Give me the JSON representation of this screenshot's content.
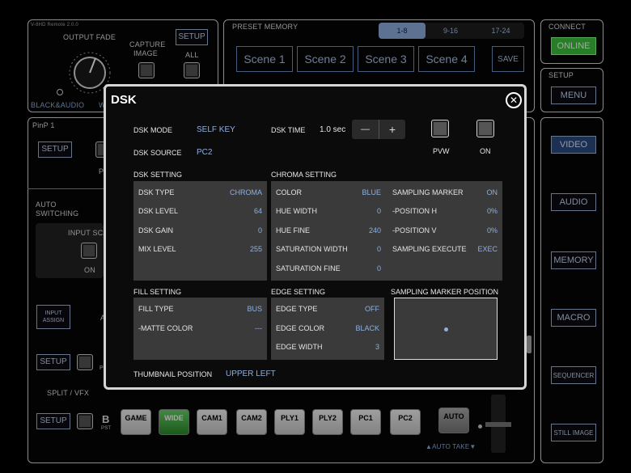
{
  "header": {
    "model": "V-8HD Remote 2.0.0"
  },
  "output_fade": {
    "title": "OUTPUT FADE",
    "capture_image": "CAPTURE IMAGE",
    "setup": "SETUP",
    "all": "ALL",
    "black_audio": "BLACK&AUDIO",
    "w_cut": "W"
  },
  "preset": {
    "title": "PRESET MEMORY",
    "tabs": [
      "1-8",
      "9-16",
      "17-24"
    ],
    "scenes": [
      "Scene 1",
      "Scene 2",
      "Scene 3",
      "Scene 4"
    ],
    "save": "SAVE"
  },
  "connect": {
    "title": "CONNECT",
    "status": "ONLINE"
  },
  "setup_side": {
    "title": "SETUP",
    "menu": "MENU"
  },
  "side_nav": [
    "VIDEO",
    "AUDIO",
    "MEMORY",
    "MACRO",
    "SEQUENCER",
    "STILL IMAGE"
  ],
  "left": {
    "pinp": "PinP 1",
    "pinp_setup": "SETUP",
    "pinp_p": "P",
    "auto_switching": "AUTO SWITCHING",
    "input_scan": "INPUT SCA",
    "on": "ON",
    "input_assign": "INPUT ASSIGN",
    "a_cut": "A",
    "setup2": "SETUP",
    "p2": "P",
    "split_vfx": "SPLIT / VFX",
    "setup3": "SETUP",
    "b": "B",
    "pst": "PST"
  },
  "crosspoints": [
    "GAME",
    "WIDE",
    "CAM1",
    "CAM2",
    "PLY1",
    "PLY2",
    "PC1",
    "PC2"
  ],
  "auto": {
    "label": "AUTO",
    "auto_take": "▲AUTO TAKE▼"
  },
  "dsk": {
    "title": "DSK",
    "mode_label": "DSK MODE",
    "mode_value": "SELF KEY",
    "source_label": "DSK SOURCE",
    "source_value": "PC2",
    "time_label": "DSK TIME",
    "time_value": "1.0 sec",
    "minus": "—",
    "plus": "+",
    "pvw": "PVW",
    "on": "ON",
    "dsk_setting": {
      "title": "DSK SETTING",
      "rows": [
        {
          "k": "DSK TYPE",
          "v": "CHROMA"
        },
        {
          "k": "DSK LEVEL",
          "v": "64"
        },
        {
          "k": "DSK GAIN",
          "v": "0"
        },
        {
          "k": "MIX LEVEL",
          "v": "255"
        }
      ]
    },
    "chroma_setting": {
      "title": "CHROMA SETTING",
      "rows": [
        {
          "k": "COLOR",
          "v": "BLUE"
        },
        {
          "k": "HUE WIDTH",
          "v": "0"
        },
        {
          "k": "HUE FINE",
          "v": "240"
        },
        {
          "k": "SATURATION WIDTH",
          "v": "0"
        },
        {
          "k": "SATURATION FINE",
          "v": "0"
        }
      ],
      "rows2": [
        {
          "k": "SAMPLING MARKER",
          "v": "ON"
        },
        {
          "k": "-POSITION H",
          "v": "0%"
        },
        {
          "k": "-POSITION V",
          "v": "0%"
        },
        {
          "k": "SAMPLING EXECUTE",
          "v": "EXEC"
        }
      ]
    },
    "fill_setting": {
      "title": "FILL SETTING",
      "rows": [
        {
          "k": "FILL TYPE",
          "v": "BUS"
        },
        {
          "k": "-MATTE COLOR",
          "v": "---"
        }
      ]
    },
    "edge_setting": {
      "title": "EDGE SETTING",
      "rows": [
        {
          "k": "EDGE TYPE",
          "v": "OFF"
        },
        {
          "k": "EDGE COLOR",
          "v": "BLACK"
        },
        {
          "k": "EDGE WIDTH",
          "v": "3"
        }
      ]
    },
    "marker_position": {
      "title": "SAMPLING MARKER POSITION"
    },
    "thumb_label": "THUMBNAIL POSITION",
    "thumb_value": "UPPER LEFT"
  }
}
